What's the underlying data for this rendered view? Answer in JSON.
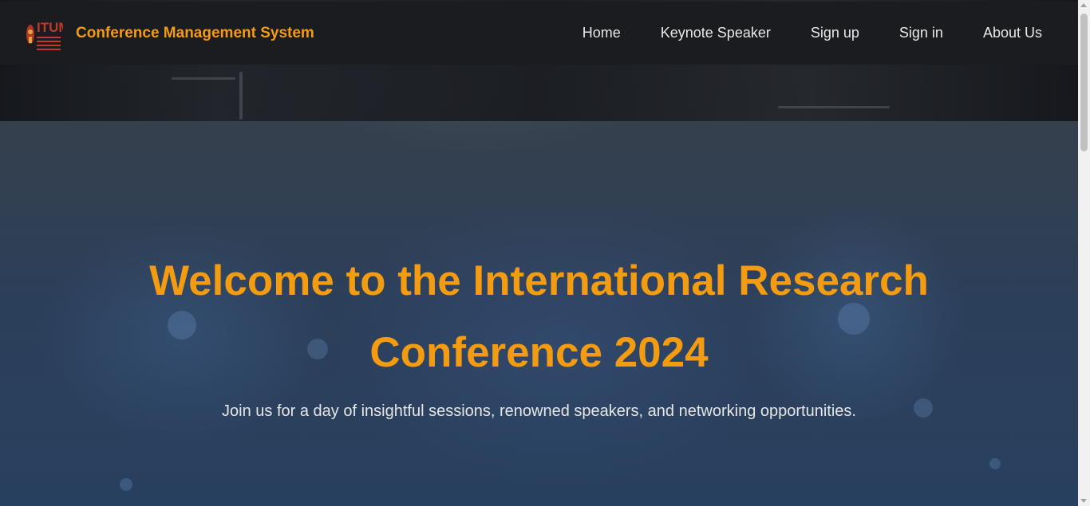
{
  "navbar": {
    "logo_icon": "itum-logo-icon",
    "logo_text": "ITUM",
    "brand": "Conference Management System",
    "links": [
      {
        "label": "Home"
      },
      {
        "label": "Keynote Speaker"
      },
      {
        "label": "Sign up"
      },
      {
        "label": "Sign in"
      },
      {
        "label": "About Us"
      }
    ]
  },
  "hero": {
    "title_line1": "Welcome to the International Research",
    "title_line2": "Conference 2024",
    "subtitle": "Join us for a day of insightful sessions, renowned speakers, and networking opportunities."
  },
  "colors": {
    "accent": "#f39c12",
    "navbar_bg": "#1a1c1f",
    "text_light": "#e8e8e8"
  }
}
